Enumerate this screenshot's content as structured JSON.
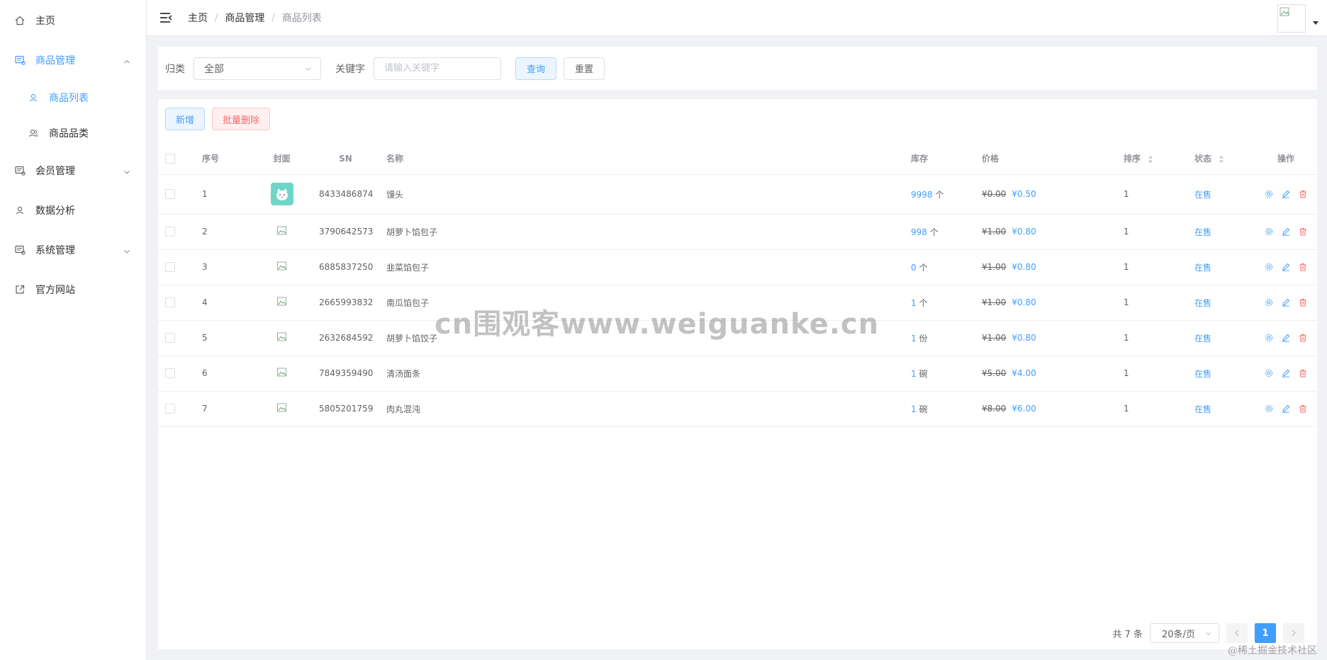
{
  "sidebar": {
    "items": [
      {
        "label": "主页",
        "icon": "home-icon"
      },
      {
        "label": "商品管理",
        "icon": "goods-icon",
        "expanded": true,
        "children": [
          {
            "label": "商品列表",
            "icon": "user-icon",
            "active": true
          },
          {
            "label": "商品品类",
            "icon": "user-group-icon"
          }
        ]
      },
      {
        "label": "会员管理",
        "icon": "member-icon"
      },
      {
        "label": "数据分析",
        "icon": "user-icon"
      },
      {
        "label": "系统管理",
        "icon": "system-icon"
      },
      {
        "label": "官方网站",
        "icon": "external-link-icon"
      }
    ]
  },
  "header": {
    "breadcrumb": [
      "主页",
      "商品管理",
      "商品列表"
    ],
    "separator": "/"
  },
  "filter": {
    "category_label": "归类",
    "category_value": "全部",
    "keyword_label": "关键字",
    "keyword_placeholder": "请输入关键字",
    "search_label": "查询",
    "reset_label": "重置"
  },
  "toolbar": {
    "add_label": "新增",
    "batch_delete_label": "批量删除"
  },
  "table": {
    "headers": [
      "序号",
      "封面",
      "SN",
      "名称",
      "库存",
      "价格",
      "排序",
      "状态",
      "操作"
    ],
    "rows": [
      {
        "index": "1",
        "sn": "8433486874",
        "name": "馒头",
        "stock": "9998",
        "unit": "个",
        "old_price": "¥0.00",
        "price": "¥0.50",
        "sort": "1",
        "status": "在售",
        "has_cover": true
      },
      {
        "index": "2",
        "sn": "3790642573",
        "name": "胡萝卜馅包子",
        "stock": "998",
        "unit": "个",
        "old_price": "¥1.00",
        "price": "¥0.80",
        "sort": "1",
        "status": "在售"
      },
      {
        "index": "3",
        "sn": "6885837250",
        "name": "韭菜馅包子",
        "stock": "0",
        "unit": "个",
        "old_price": "¥1.00",
        "price": "¥0.80",
        "sort": "1",
        "status": "在售"
      },
      {
        "index": "4",
        "sn": "2665993832",
        "name": "南瓜馅包子",
        "stock": "1",
        "unit": "个",
        "old_price": "¥1.00",
        "price": "¥0.80",
        "sort": "1",
        "status": "在售"
      },
      {
        "index": "5",
        "sn": "2632684592",
        "name": "胡萝卜馅饺子",
        "stock": "1",
        "unit": "份",
        "old_price": "¥1.00",
        "price": "¥0.80",
        "sort": "1",
        "status": "在售"
      },
      {
        "index": "6",
        "sn": "7849359490",
        "name": "清汤面条",
        "stock": "1",
        "unit": "碗",
        "old_price": "¥5.00",
        "price": "¥4.00",
        "sort": "1",
        "status": "在售"
      },
      {
        "index": "7",
        "sn": "5805201759",
        "name": "肉丸混沌",
        "stock": "1",
        "unit": "碗",
        "old_price": "¥8.00",
        "price": "¥6.00",
        "sort": "1",
        "status": "在售"
      }
    ]
  },
  "pagination": {
    "total_text": "共 7 条",
    "page_size": "20条/页",
    "current_page": "1"
  },
  "watermark": "cn围观客www.weiguanke.cn",
  "site_mark": "@稀土掘金技术社区",
  "colors": {
    "primary": "#409eff",
    "danger": "#f56c6c"
  }
}
